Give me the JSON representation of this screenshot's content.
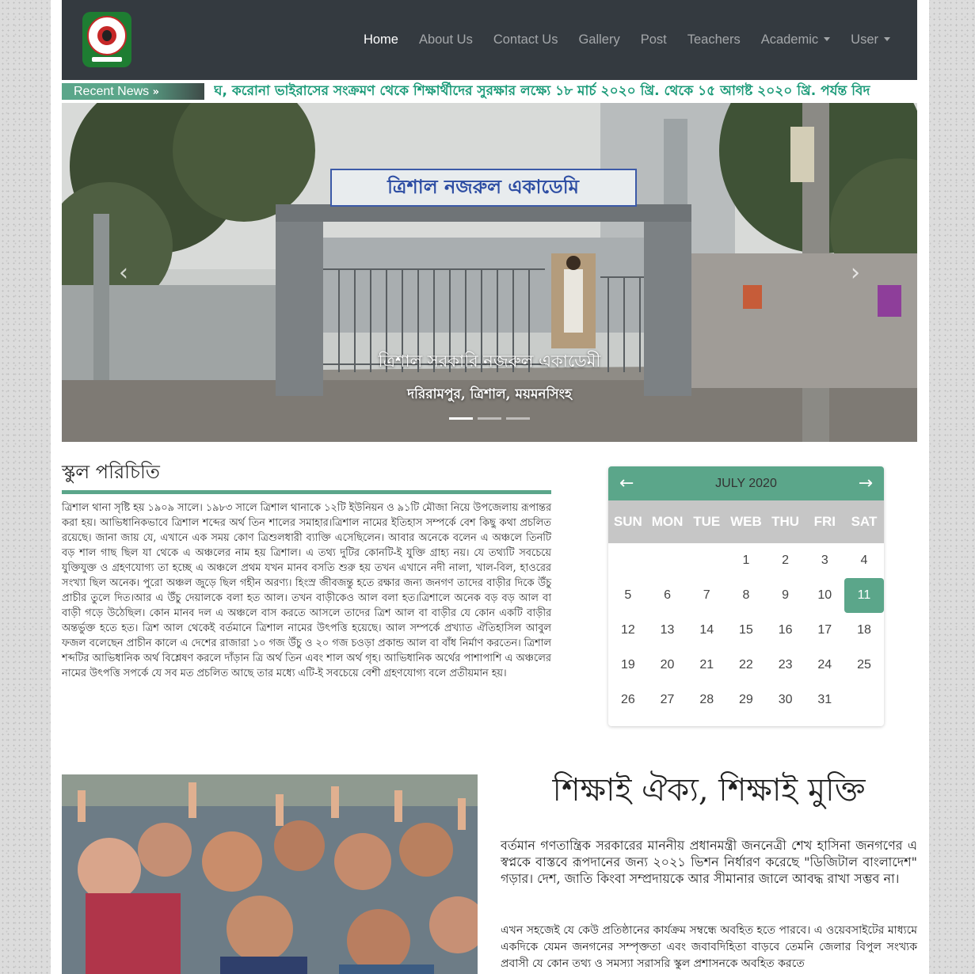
{
  "nav": {
    "items": [
      {
        "label": "Home",
        "active": true
      },
      {
        "label": "About Us"
      },
      {
        "label": "Contact Us"
      },
      {
        "label": "Gallery"
      },
      {
        "label": "Post"
      },
      {
        "label": "Teachers"
      },
      {
        "label": "Academic",
        "dropdown": true
      },
      {
        "label": "User",
        "dropdown": true
      }
    ]
  },
  "news": {
    "label": "Recent News",
    "ticker": "ঘ, করোনা ভাইরাসের সংক্রমণ থেকে শিক্ষার্থীদের সুরক্ষার লক্ষ্যে ১৮ মার্চ ২০২০ খ্রি. থেকে ১৫ আগষ্ট ২০২০ খ্রি. পর্যন্ত বিদ"
  },
  "carousel": {
    "gate_sign": "ত্রিশাল নজরুল একাডেমি",
    "title": "ত্রিশাল সরকারি নজরুল একাডেমী",
    "subtitle": "দরিরামপুর, ত্রিশাল, ময়মনসিংহ",
    "slide_count": 3,
    "active_slide": 1
  },
  "intro": {
    "heading": "স্কুল পরিচিতি",
    "text": "ত্রিশাল থানা সৃষ্টি হয় ১৯০৯ সালে। ১৯৮৩ সালে ত্রিশাল থানাকে ১২টি ইউনিয়ন ও ৯১টি মৌজা নিয়ে উপজেলায় রূপান্তর করা হয়। আভিধানিকভাবে ত্রিশাল শব্দের অর্থ তিন শালের সমাহার।ত্রিশাল নামের ইতিহাস সম্পর্কে বেশ কিছু কথা প্রচলিত রয়েছে। জানা জায় যে, এখানে এক সময় কোণ ত্রিশুলধারী ব্যাক্তি এসেছিলেন। আবার অনেকে বলেন এ অঞ্চলে তিনটি বড় শাল গাছ ছিল যা থেকে এ অঞ্চলের নাম হয় ত্রিশাল। এ তথ্য দুটির কোনটি-ই যুক্তি গ্রাহ্য নয়। যে তথ্যটি সবচেয়ে যুক্তিযুক্ত ও গ্রহণযোগ্য তা হচ্ছে এ অঞ্চলে প্রথম যখন মানব বসতি শুরু হয় তখন এখানে নদী নালা, খাল-বিল, হাওরের সংখ্যা ছিল অনেক। পুরো অঞ্চল জুড়ে ছিল গহীন অরণ্য। হিংস্র জীবজন্তু হতে রক্ষার জন্য জনগণ তাদের বাড়ীর দিকে উঁচু প্রাচীর তুলে দিত।আর এ উঁচু দেয়ালকে বলা হত আল। তখন বাড়ীকেও আল বলা হত।ত্রিশালে অনেক বড় বড় আল বা বাড়ী গড়ে উঠেছিল। কোন মানব দল এ অঞ্চলে বাস করতে আসলে তাদের ত্রিশ আল বা বাড়ীর যে কোন একটি বাড়ীর অন্তর্ভুক্ত হতে হত। ত্রিশ আল থেকেই বর্তমানে ত্রিশাল নামের উৎপত্তি হয়েছে। আল সম্পর্কে প্রখ্যাত ঐতিহাসিল আবুল ফজল বলেছেন প্রাচীন কালে এ দেশের রাজারা ১০ গজ উঁচু ও ২০ গজ চওড়া প্রকান্ড আল বা বাঁধ নির্মাণ করতেন। ত্রিশাল শব্দটির আভিধানিক অর্থ বিশ্লেষণ করলে দাঁড়ান ত্রি অর্থ তিন এবং শাল অর্থ গৃহ। আভিধানিক অর্থের পাশাপাশি এ অঞ্চলের নামের উৎপত্তি সপর্কে যে সব মত প্রচলিত আছে তার মধ্যে এটি-ই সবচেয়ে বেশী গ্রহণযোগ্য বলে প্রতীয়মান হয়।"
  },
  "calendar": {
    "month_label": "JULY 2020",
    "weekdays": [
      "SUN",
      "MON",
      "TUE",
      "WEB",
      "THU",
      "FRI",
      "SAT"
    ],
    "leading_blanks": 3,
    "days": [
      "1",
      "2",
      "3",
      "4",
      "5",
      "6",
      "7",
      "8",
      "9",
      "10",
      "11",
      "12",
      "13",
      "14",
      "15",
      "16",
      "17",
      "18",
      "19",
      "20",
      "21",
      "22",
      "23",
      "24",
      "25",
      "26",
      "27",
      "28",
      "29",
      "30",
      "31"
    ],
    "today": "11"
  },
  "slogan": {
    "title": "শিক্ষাই ঐক্য, শিক্ষাই মুক্তি",
    "para1": "বর্তমান গণতান্ত্রিক সরকারের মাননীয় প্রধানমন্ত্রী জননেত্রী শেখ হাসিনা জনগণের এ স্বপ্নকে বাস্তবে রূপদানের জন্য ২০২১ ভিশন নির্ধারণ করেছে \"ডিজিটাল বাংলাদেশ\" গড়ার। দেশ, জাতি কিংবা সম্প্রদায়কে আর সীমানার জালে আবদ্ধ রাখা সম্ভব না।",
    "para2": "এখন সহজেই যে কেউ প্রতিষ্ঠানের কার্যক্রম সম্বন্ধে অবহিত হতে পারবে। এ ওয়েবসাইটের মাধ্যমে একদিকে যেমন জনগনের সম্পৃক্ততা এবং জবাবদিহিতা বাড়বে তেমনি জেলার বিপুল সংখ্যক প্রবাসী যে কোন তথ্য ও সমস্যা সরাসরি স্কুল প্রশাসনকে অবহিত করতে"
  },
  "colors": {
    "accent": "#5ba68a",
    "navbar": "#343a40",
    "ticker_text": "#1a9a78"
  }
}
